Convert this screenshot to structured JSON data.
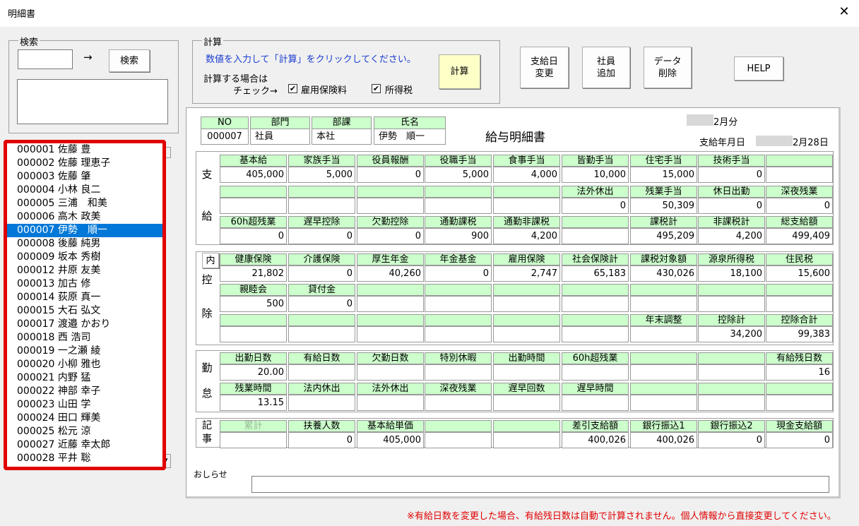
{
  "window": {
    "title": "明細書",
    "close": "✕"
  },
  "search": {
    "group_label": "検索",
    "arrow": "→",
    "button": "検索",
    "value": "",
    "result": ""
  },
  "calc": {
    "group_label": "計算",
    "instruction": "数値を入力して「計算」をクリックしてください。",
    "check_label_1": "計算する場合は",
    "check_label_2": "チェック→",
    "chk_koyo": "雇用保険料",
    "chk_shotoku": "所得税",
    "button": "計算"
  },
  "buttons": {
    "pay_day_1": "支給日",
    "pay_day_2": "変更",
    "add_emp_1": "社員",
    "add_emp_2": "追加",
    "del_data_1": "データ",
    "del_data_2": "削除",
    "help": "HELP"
  },
  "employees": [
    "000001 佐藤 豊",
    "000002 佐藤 理恵子",
    "000003 佐藤 肇",
    "000004 小林 良二",
    "000005 三浦　和美",
    "000006 高木 政美",
    "000007 伊勢　順一",
    "000008 後藤 純男",
    "000009 坂本 秀樹",
    "000012 井原 友美",
    "000013 加古 修",
    "000014 荻原 真一",
    "000015 大石 弘文",
    "000017 渡邉 かおり",
    "000018 西 浩司",
    "000019 一之瀬 綾",
    "000020 小柳 雅也",
    "000021 内野 猛",
    "000022 神部 幸子",
    "000023 山田 学",
    "000024 田口 輝美",
    "000025 松元 涼",
    "000027 近藤 幸太郎",
    "000028 平井 聡"
  ],
  "selected_index": 6,
  "slip": {
    "title": "給与明細書",
    "month": "2月分",
    "pay_date_label": "支給年月日",
    "pay_date": "2月28日",
    "hdr": {
      "no_h": "NO",
      "no": "000007",
      "dept_h": "部門",
      "dept": "社員",
      "sect_h": "部課",
      "sect": "本社",
      "name_h": "氏名",
      "name": "伊勢　順一"
    },
    "shikyu": {
      "side1": "支",
      "side2": "給",
      "r1h": [
        "基本給",
        "家族手当",
        "役員報酬",
        "役職手当",
        "食事手当",
        "皆勤手当",
        "住宅手当",
        "技術手当",
        ""
      ],
      "r1v": [
        "405,000",
        "5,000",
        "0",
        "5,000",
        "4,000",
        "10,000",
        "15,000",
        "0",
        ""
      ],
      "r2h": [
        "",
        "",
        "",
        "",
        "",
        "法外休出",
        "残業手当",
        "休日出勤",
        "深夜残業"
      ],
      "r2v": [
        "",
        "",
        "",
        "",
        "",
        "0",
        "50,309",
        "0",
        "0"
      ],
      "r3h": [
        "60h超残業",
        "遅早控除",
        "欠勤控除",
        "通勤課税",
        "通勤非課税",
        "",
        "課税計",
        "非課税計",
        "総支給額"
      ],
      "r3v": [
        "0",
        "0",
        "0",
        "900",
        "4,200",
        "",
        "495,209",
        "4,200",
        "499,409"
      ]
    },
    "kojo": {
      "side1": "控",
      "side2": "除",
      "uchi": "内",
      "r1h": [
        "健康保険",
        "介護保険",
        "厚生年金",
        "年金基金",
        "雇用保険",
        "社会保険計",
        "課税対象額",
        "源泉所得税",
        "住民税"
      ],
      "r1v": [
        "21,802",
        "0",
        "40,260",
        "0",
        "2,747",
        "65,183",
        "430,026",
        "18,100",
        "15,600"
      ],
      "r2h": [
        "親睦会",
        "貸付金",
        "",
        "",
        "",
        "",
        "",
        "",
        ""
      ],
      "r2v": [
        "500",
        "0",
        "",
        "",
        "",
        "",
        "",
        "",
        ""
      ],
      "r3h": [
        "",
        "",
        "",
        "",
        "",
        "",
        "年末調整",
        "控除計",
        "控除合計"
      ],
      "r3v": [
        "",
        "",
        "",
        "",
        "",
        "",
        "",
        "34,200",
        "99,383"
      ]
    },
    "kintai": {
      "side1": "勤",
      "side2": "怠",
      "r1h": [
        "出勤日数",
        "有給日数",
        "欠勤日数",
        "特別休暇",
        "出勤時間",
        "60h超残業",
        "",
        "",
        "有給残日数"
      ],
      "r1v": [
        "20.00",
        "",
        "",
        "",
        "",
        "",
        "",
        "",
        "16"
      ],
      "r2h": [
        "残業時間",
        "法内休出",
        "法外休出",
        "深夜残業",
        "遅早回数",
        "遅早時間",
        "",
        "",
        ""
      ],
      "r2v": [
        "13.15",
        "",
        "",
        "",
        "",
        "",
        "",
        "",
        ""
      ]
    },
    "kiji": {
      "side1": "記",
      "side2": "事",
      "r1h": [
        "累計",
        "扶養人数",
        "基本給単価",
        "",
        "",
        "差引支給額",
        "銀行振込1",
        "銀行振込2",
        "現金支給額"
      ],
      "r1v": [
        "",
        "0",
        "405,000",
        "",
        "",
        "400,026",
        "400,026",
        "0",
        "0"
      ]
    },
    "notice_label": "おしらせ",
    "notice": ""
  },
  "footer_note": "※有給日数を変更した場合、有給残日数は自動で計算されません。個人情報から直接変更してください。"
}
